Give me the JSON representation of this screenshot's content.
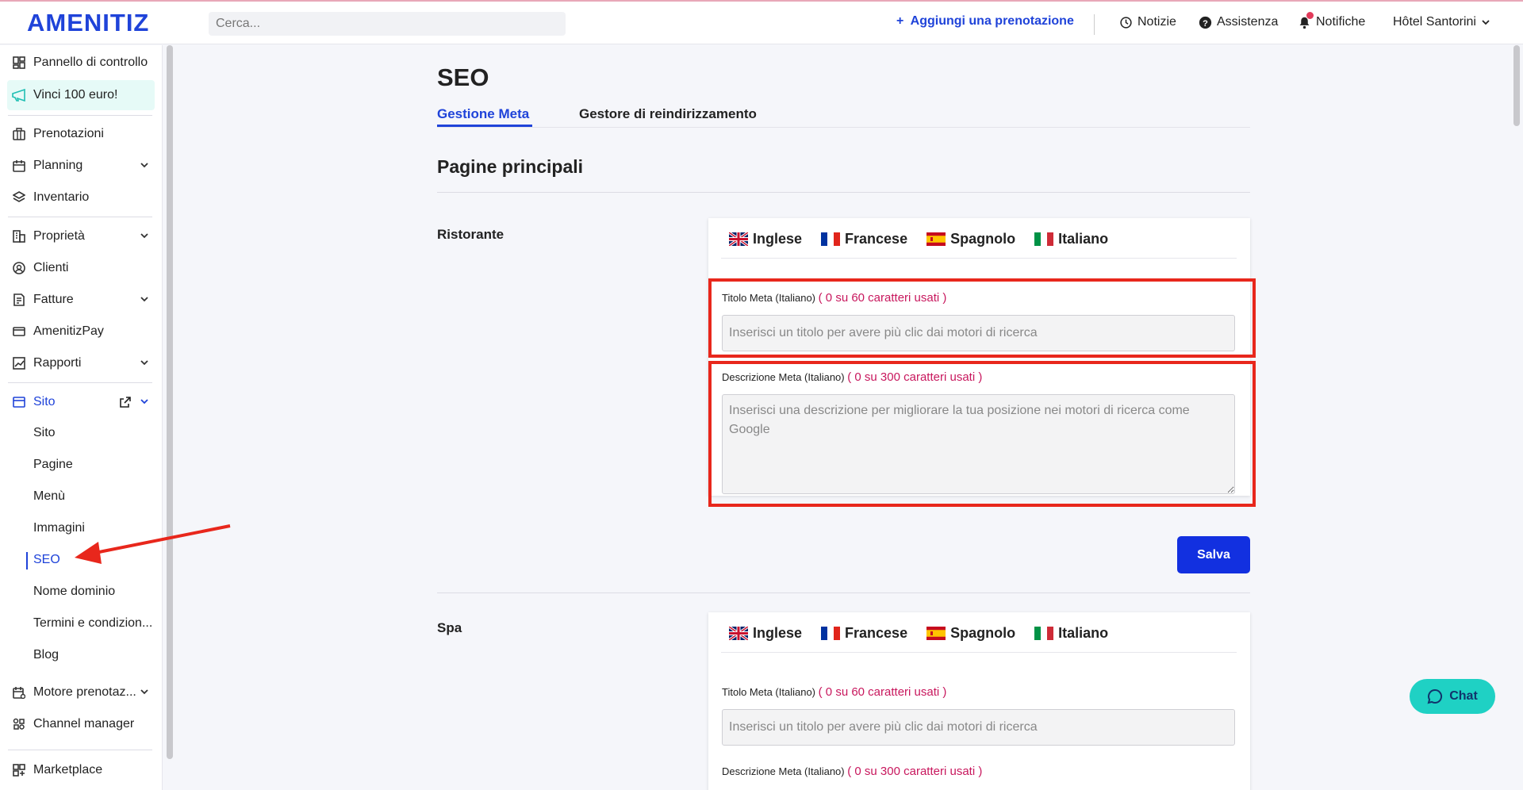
{
  "header": {
    "logo": "AMENITIZ",
    "search_placeholder": "Cerca...",
    "add_booking": "Aggiungi una prenotazione",
    "links": [
      "Notizie",
      "Assistenza",
      "Notifiche"
    ],
    "hotel": "Hôtel Santorini"
  },
  "sidebar": {
    "items": [
      {
        "label": "Pannello di controllo",
        "icon": "dashboard-icon"
      },
      {
        "label": "Vinci 100 euro!",
        "icon": "megaphone-icon"
      },
      {
        "label": "Prenotazioni",
        "icon": "suitcase-icon"
      },
      {
        "label": "Planning",
        "icon": "calendar-icon"
      },
      {
        "label": "Inventario",
        "icon": "layers-icon"
      },
      {
        "label": "Proprietà",
        "icon": "building-icon"
      },
      {
        "label": "Clienti",
        "icon": "face-icon"
      },
      {
        "label": "Fatture",
        "icon": "invoice-icon"
      },
      {
        "label": "AmenitizPay",
        "icon": "card-icon"
      },
      {
        "label": "Rapporti",
        "icon": "chart-icon"
      },
      {
        "label": "Sito",
        "icon": "browser-icon"
      },
      {
        "label": "Motore prenotaz...",
        "icon": "booking-engine-icon"
      },
      {
        "label": "Channel manager",
        "icon": "channel-icon"
      },
      {
        "label": "Marketplace",
        "icon": "marketplace-icon"
      }
    ],
    "site_sub": [
      "Sito",
      "Pagine",
      "Menù",
      "Immagini",
      "SEO",
      "Nome dominio",
      "Termini e condizion...",
      "Blog"
    ]
  },
  "main": {
    "title": "SEO",
    "tabs": [
      "Gestione Meta",
      "Gestore di reindirizzamento"
    ],
    "section_title": "Pagine principali",
    "languages": [
      "Inglese",
      "Francese",
      "Spagnolo",
      "Italiano"
    ],
    "pages": [
      {
        "label": "Ristorante",
        "meta_title_label": "Titolo Meta (Italiano)",
        "meta_title_counter": "( 0 su 60 caratteri usati )",
        "meta_title_placeholder": "Inserisci un titolo per avere più clic dai motori di ricerca",
        "meta_desc_label": "Descrizione Meta (Italiano)",
        "meta_desc_counter": "( 0 su 300 caratteri usati )",
        "meta_desc_placeholder": "Inserisci una descrizione per migliorare la tua posizione nei motori di ricerca come Google"
      },
      {
        "label": "Spa",
        "meta_title_label": "Titolo Meta (Italiano)",
        "meta_title_counter": "( 0 su 60 caratteri usati )",
        "meta_title_placeholder": "Inserisci un titolo per avere più clic dai motori di ricerca",
        "meta_desc_label": "Descrizione Meta (Italiano)",
        "meta_desc_counter": "( 0 su 300 caratteri usati )"
      }
    ],
    "save": "Salva"
  },
  "chat": "Chat",
  "colors": {
    "accent": "#1f43d9",
    "highlight": "#e8271c",
    "counter": "#c8175d",
    "chat": "#1fd1c4"
  }
}
